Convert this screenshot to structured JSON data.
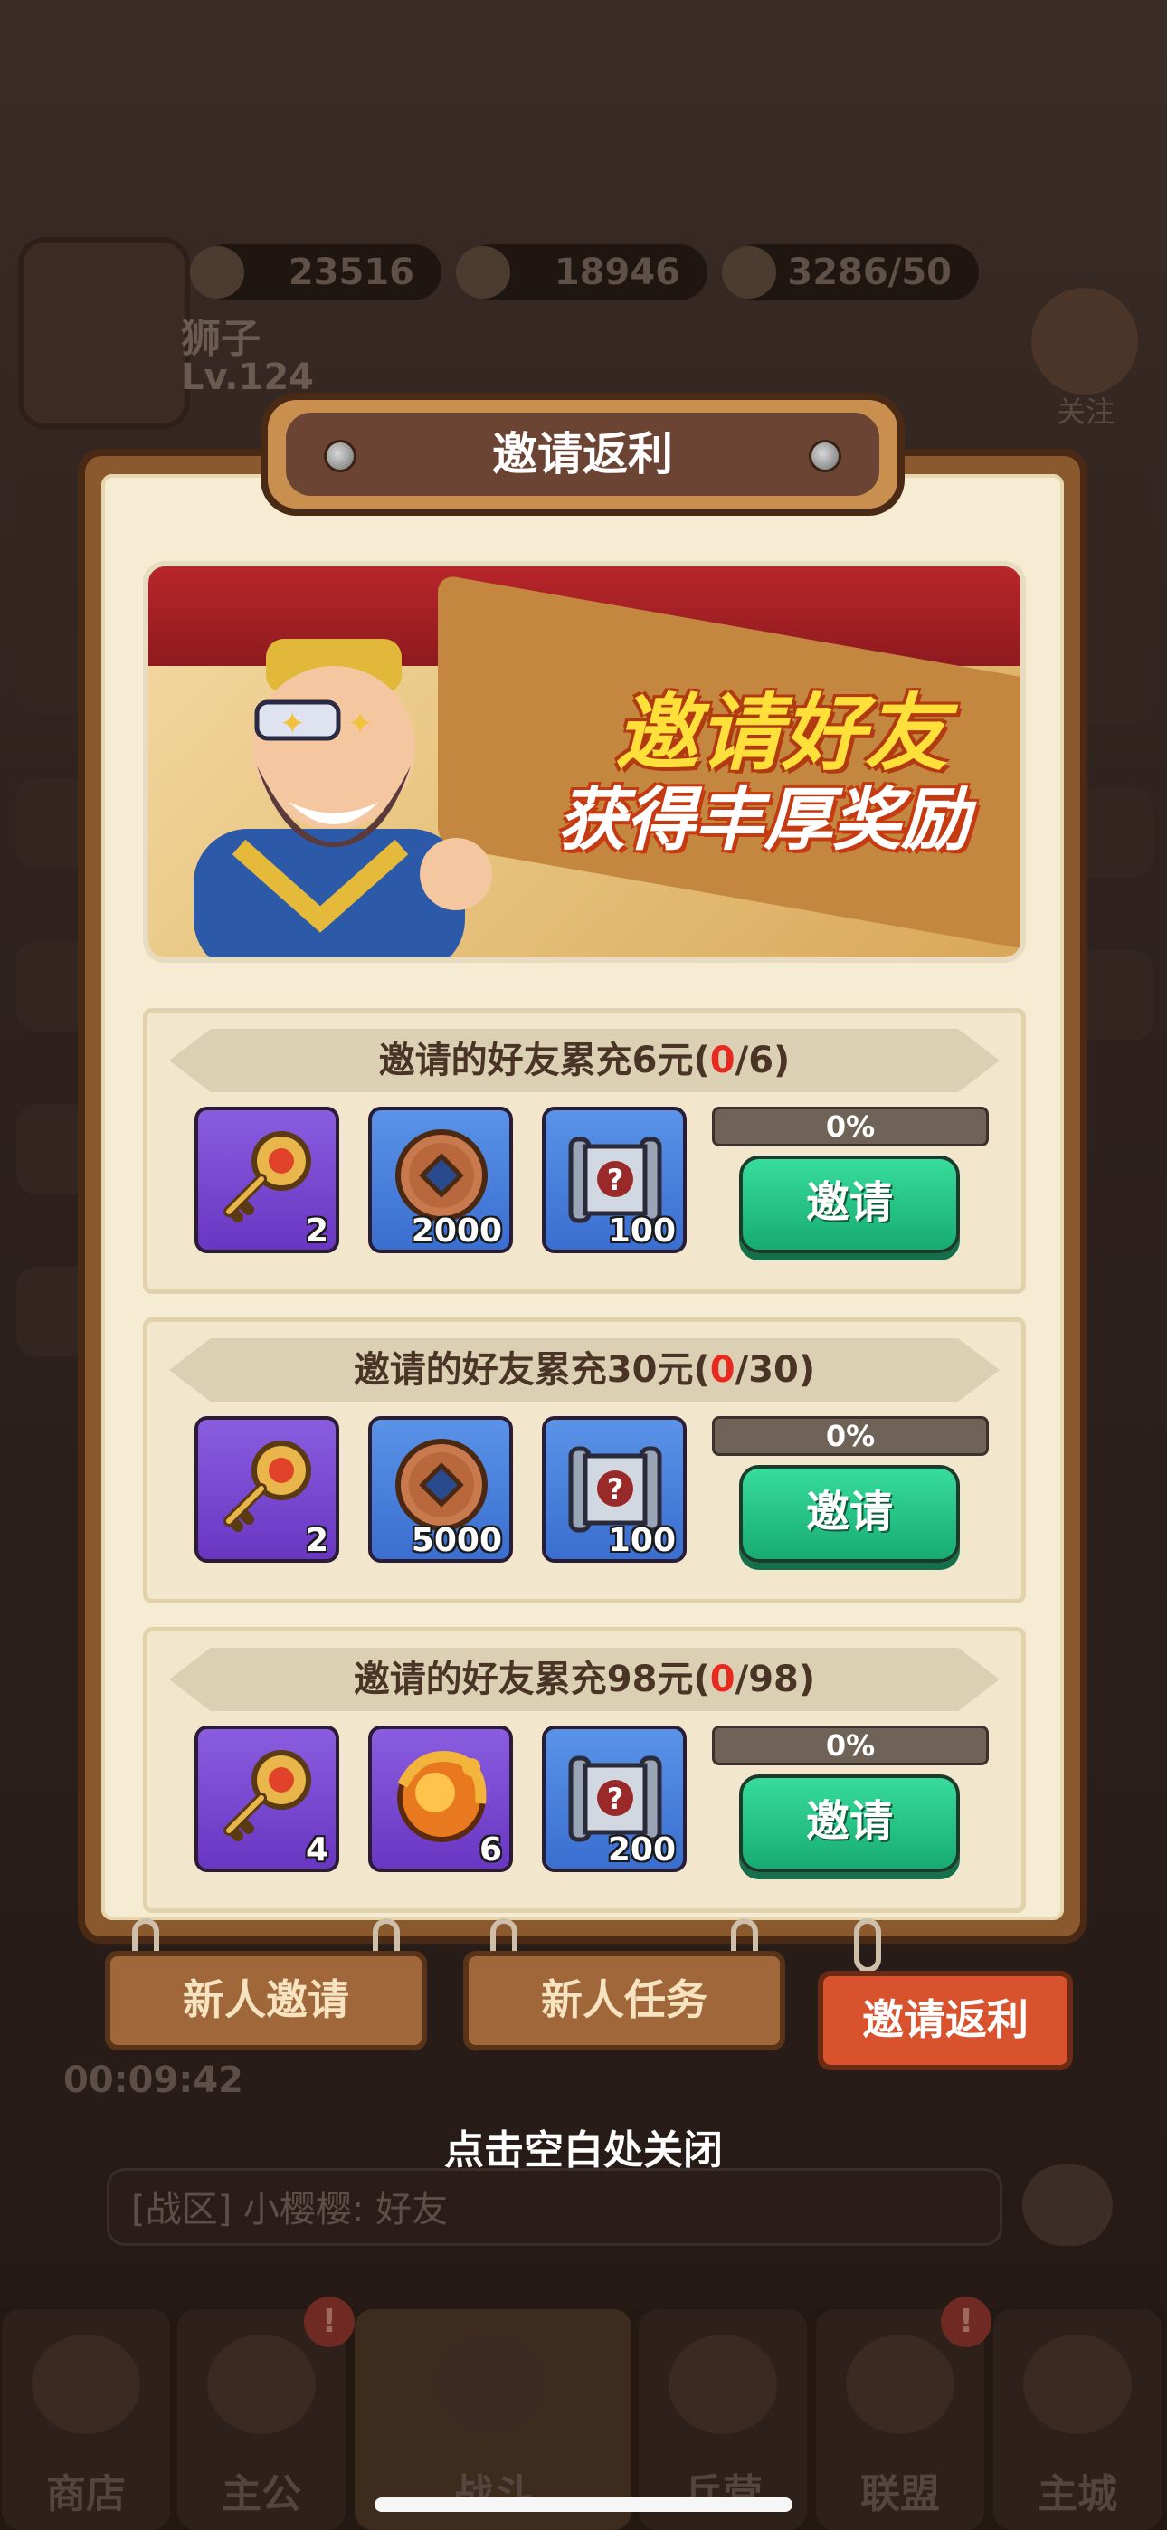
{
  "resources": [
    {
      "icon": "ingot-icon",
      "value": "23516"
    },
    {
      "icon": "coin-icon",
      "value": "18946"
    },
    {
      "icon": "helmet-icon",
      "value": "3286/50"
    }
  ],
  "player": {
    "name": "狮子",
    "level": "Lv.124"
  },
  "follow_label": "关注",
  "timer": "00:09:42",
  "chat": {
    "text": "[战区] 小樱樱: 好友"
  },
  "nav": [
    {
      "label": "商店",
      "icon": "shop-icon",
      "badge": ""
    },
    {
      "label": "主公",
      "icon": "lord-icon",
      "badge": "!"
    },
    {
      "label": "战斗",
      "icon": "crossed-swords-icon",
      "badge": ""
    },
    {
      "label": "兵营",
      "icon": "barracks-icon",
      "badge": ""
    },
    {
      "label": "联盟",
      "icon": "alliance-icon",
      "badge": "!"
    },
    {
      "label": "主城",
      "icon": "city-icon",
      "badge": ""
    }
  ],
  "modal": {
    "title": "邀请返利",
    "banner": {
      "line1": "邀请好友",
      "line2": "获得丰厚奖励"
    },
    "tiers": [
      {
        "prefix": "邀请的好友累充6元(",
        "current": "0",
        "suffix": "/6)",
        "rewards": [
          {
            "icon": "golden-key-icon",
            "qty": "2",
            "rarity": "purple"
          },
          {
            "icon": "copper-coin-icon",
            "qty": "2000",
            "rarity": "blue"
          },
          {
            "icon": "mystery-scroll-icon",
            "qty": "100",
            "rarity": "blue"
          }
        ],
        "progress_label": "0%",
        "progress": 0,
        "button": "邀请"
      },
      {
        "prefix": "邀请的好友累充30元(",
        "current": "0",
        "suffix": "/30)",
        "rewards": [
          {
            "icon": "golden-key-icon",
            "qty": "2",
            "rarity": "purple"
          },
          {
            "icon": "copper-coin-icon",
            "qty": "5000",
            "rarity": "blue"
          },
          {
            "icon": "mystery-scroll-icon",
            "qty": "100",
            "rarity": "blue"
          }
        ],
        "progress_label": "0%",
        "progress": 0,
        "button": "邀请"
      },
      {
        "prefix": "邀请的好友累充98元(",
        "current": "0",
        "suffix": "/98)",
        "rewards": [
          {
            "icon": "golden-key-icon",
            "qty": "4",
            "rarity": "purple"
          },
          {
            "icon": "dragon-orb-icon",
            "qty": "6",
            "rarity": "purple"
          },
          {
            "icon": "mystery-scroll-icon",
            "qty": "200",
            "rarity": "blue"
          }
        ],
        "progress_label": "0%",
        "progress": 0,
        "button": "邀请"
      }
    ],
    "tabs": [
      {
        "label": "新人邀请",
        "active": false
      },
      {
        "label": "新人任务",
        "active": false
      },
      {
        "label": "邀请返利",
        "active": true
      }
    ]
  },
  "close_hint": "点击空白处关闭",
  "colors": {
    "accent_green": "#17ab72",
    "progress_red": "#e8291f",
    "active_tab": "#d8522e"
  }
}
